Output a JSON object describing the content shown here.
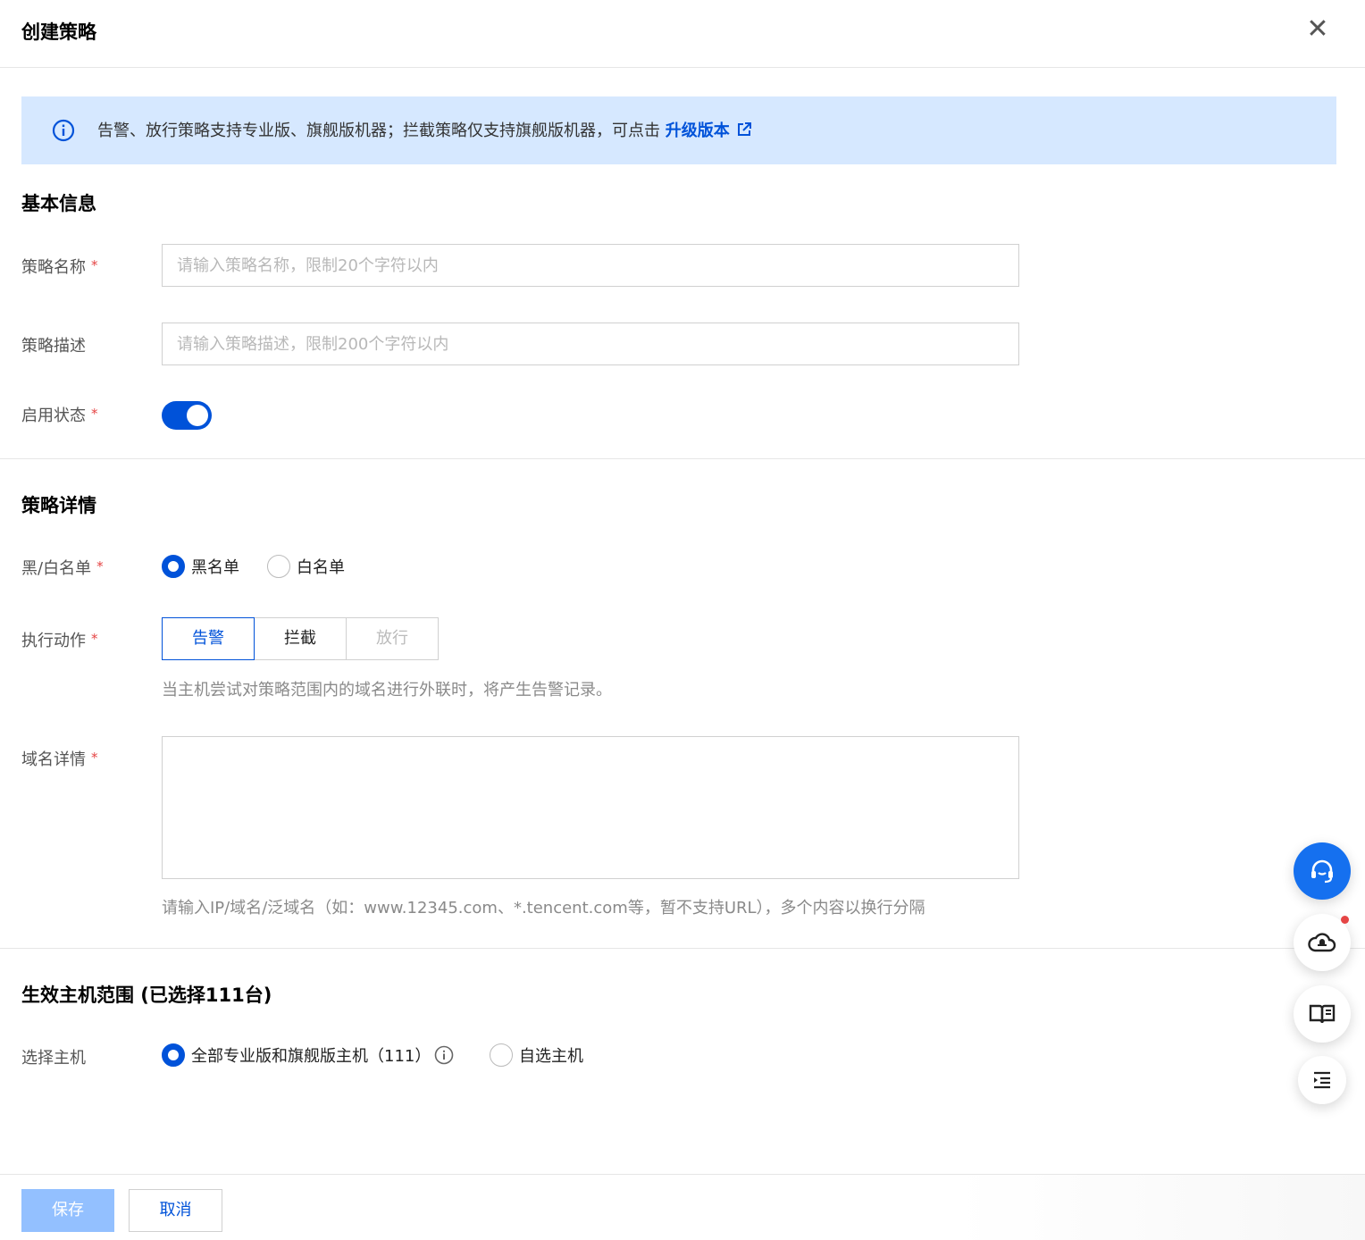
{
  "dialog": {
    "title": "创建策略",
    "close_icon": "close-icon"
  },
  "notice": {
    "icon": "info-icon",
    "text": "告警、放行策略支持专业版、旗舰版机器；拦截策略仅支持旗舰版机器，可点击 ",
    "link_label": "升级版本",
    "link_icon": "external-link-icon"
  },
  "basic_info": {
    "title": "基本信息",
    "name_label": "策略名称",
    "name_placeholder": "请输入策略名称，限制20个字符以内",
    "desc_label": "策略描述",
    "desc_placeholder": "请输入策略描述，限制200个字符以内",
    "status_label": "启用状态",
    "status_enabled": true
  },
  "detail": {
    "title": "策略详情",
    "list_label": "黑/白名单",
    "list_options": [
      {
        "label": "黑名单",
        "selected": true
      },
      {
        "label": "白名单",
        "selected": false
      }
    ],
    "action_label": "执行动作",
    "action_options": [
      {
        "label": "告警",
        "state": "active"
      },
      {
        "label": "拦截",
        "state": "normal"
      },
      {
        "label": "放行",
        "state": "disabled"
      }
    ],
    "action_help": "当主机尝试对策略范围内的域名进行外联时，将产生告警记录。",
    "domain_label": "域名详情",
    "domain_value": "",
    "domain_help": "请输入IP/域名/泛域名（如：www.12345.com、*.tencent.com等，暂不支持URL），多个内容以换行分隔"
  },
  "scope": {
    "title": "生效主机范围 (已选择111台)",
    "host_label": "选择主机",
    "host_options": [
      {
        "label": "全部专业版和旗舰版主机（111）",
        "selected": true,
        "icon": "info-icon"
      },
      {
        "label": "自选主机",
        "selected": false
      }
    ]
  },
  "footer": {
    "save_label": "保存",
    "cancel_label": "取消"
  },
  "floating": [
    {
      "icon": "headset-icon"
    },
    {
      "icon": "cloud-notification-icon",
      "badge": true
    },
    {
      "icon": "book-icon"
    },
    {
      "icon": "list-indent-icon"
    }
  ],
  "colors": {
    "primary": "#0052d9",
    "notice_bg": "#d6e8ff",
    "required": "#e54545",
    "save_disabled": "#93c0ff"
  }
}
